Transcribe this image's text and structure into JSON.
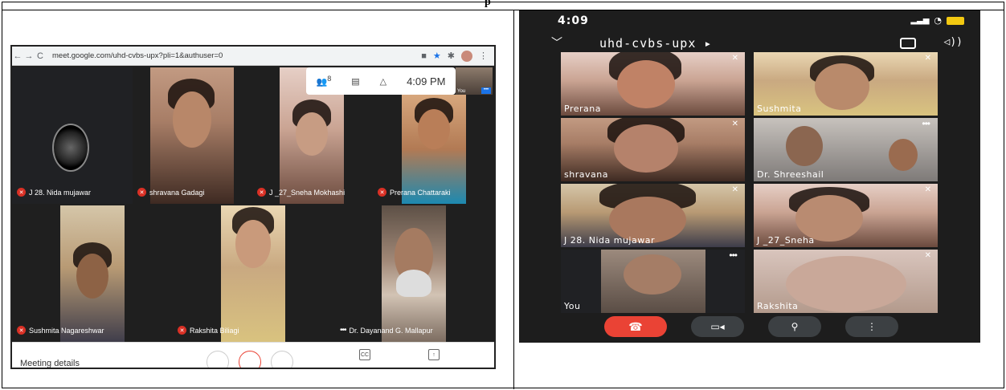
{
  "caption": {
    "fragment": "p"
  },
  "desktop": {
    "url": "meet.google.com/uhd-cvbs-upx?pli=1&authuser=0",
    "clock": "4:09 PM",
    "people_count": "8",
    "you_label": "You",
    "meeting_details": "Meeting details",
    "cc_label": "CC",
    "participants": [
      {
        "name": "J 28. Nida mujawar",
        "muted": true
      },
      {
        "name": "shravana Gadagi",
        "muted": true
      },
      {
        "name": "J _27_Sneha Mokhashi",
        "muted": true
      },
      {
        "name": "Prerana Chattaraki",
        "muted": true
      },
      {
        "name": "Sushmita Nagareshwar",
        "muted": true
      },
      {
        "name": "Rakshita Biliagi",
        "muted": true
      },
      {
        "name": "Dr. Dayanand G. Mallapur",
        "muted": false
      }
    ]
  },
  "phone": {
    "time": "4:09",
    "meeting_code": "uhd-cvbs-upx",
    "tiles": [
      {
        "name": "Prerana"
      },
      {
        "name": "Sushmita"
      },
      {
        "name": "shravana"
      },
      {
        "name": "Dr. Shreeshail"
      },
      {
        "name": "J 28. Nida mujawar"
      },
      {
        "name": "J _27_Sneha"
      },
      {
        "name": "You"
      },
      {
        "name": "Rakshita"
      }
    ]
  },
  "icons": {
    "muted": "mic-off-icon",
    "end_call": "end-call-icon",
    "camera": "camera-icon",
    "mic": "mic-icon",
    "more": "more-icon"
  }
}
